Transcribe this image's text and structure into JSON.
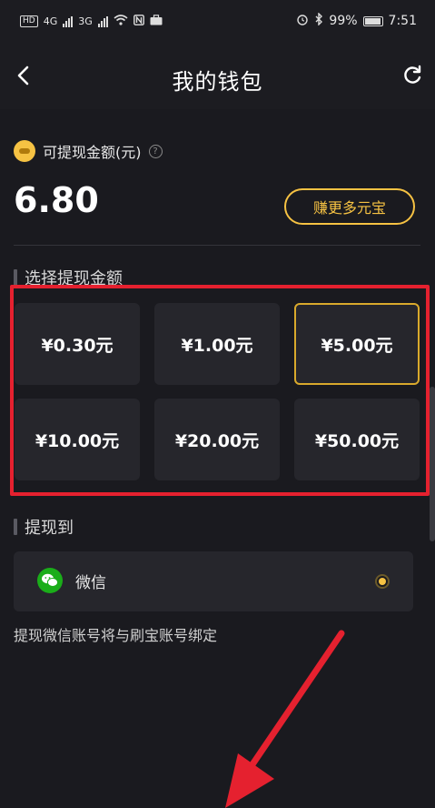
{
  "status_bar": {
    "hd": "HD",
    "net1": "4G",
    "net2": "3G",
    "battery": "99%",
    "time": "7:51"
  },
  "nav": {
    "title": "我的钱包"
  },
  "balance": {
    "label": "可提现金额(元)",
    "amount": "6.80",
    "earn_button": "赚更多元宝"
  },
  "amount_section": {
    "title": "选择提现金额",
    "options": [
      "¥0.30元",
      "¥1.00元",
      "¥5.00元",
      "¥10.00元",
      "¥20.00元",
      "¥50.00元"
    ],
    "selected_index": 2
  },
  "withdraw_section": {
    "title": "提现到",
    "method": "微信",
    "hint": "提现微信账号将与刷宝账号绑定"
  },
  "colors": {
    "background": "#1a1a1f",
    "accent": "#f6c243",
    "highlight": "#e5212f",
    "wechat": "#1aad19"
  }
}
